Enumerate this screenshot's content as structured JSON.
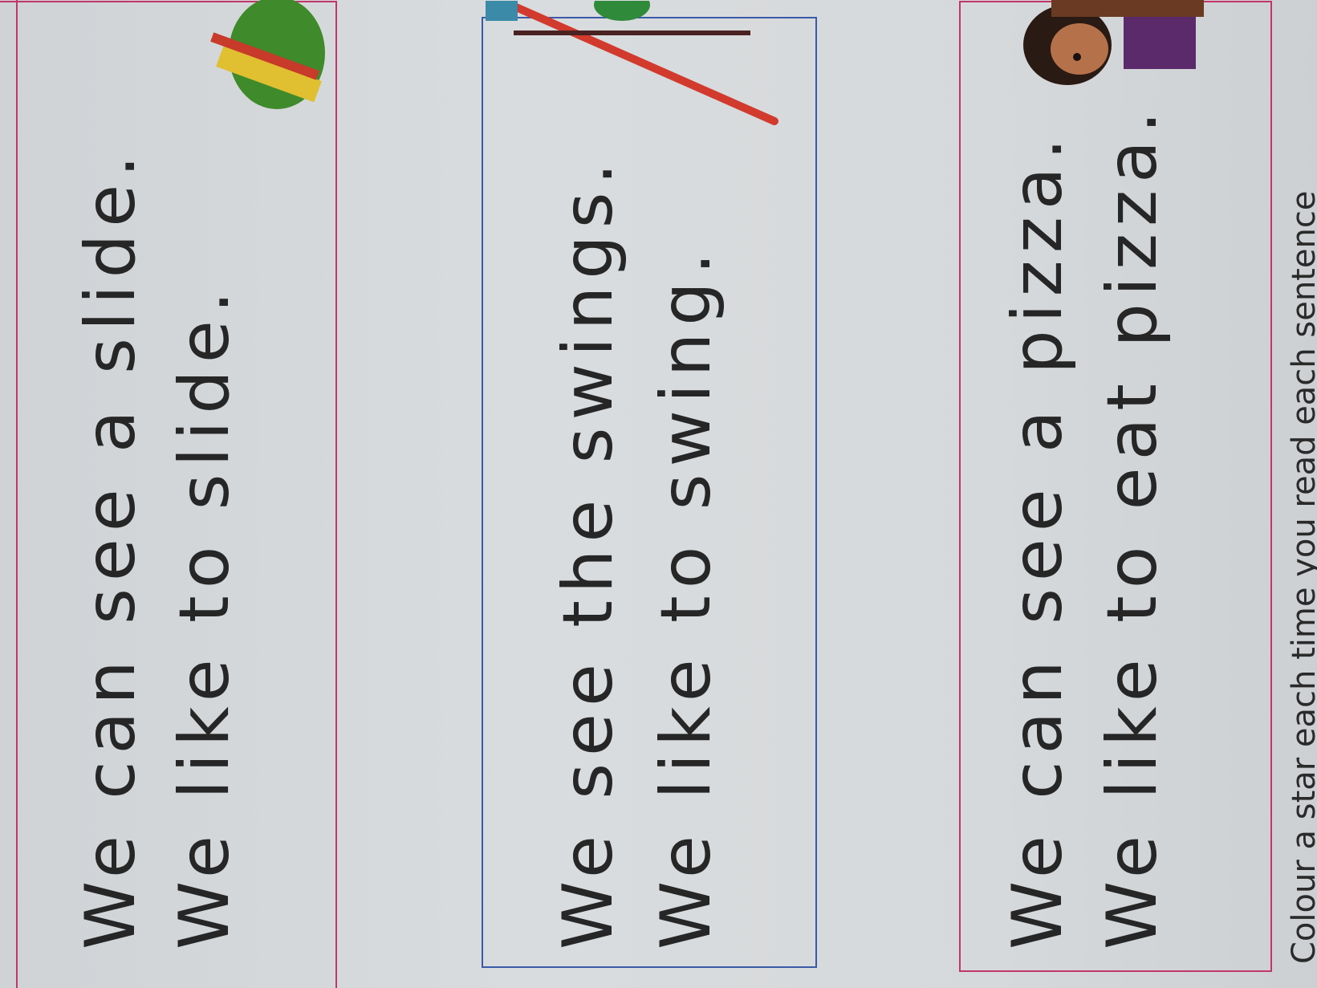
{
  "boxes": [
    {
      "lines": [
        "We can see a slide.",
        "We like to slide."
      ]
    },
    {
      "lines": [
        "We see the swings.",
        "We like to swing."
      ]
    },
    {
      "lines": [
        "We can see a pizza.",
        "We like to eat pizza."
      ]
    }
  ],
  "instruction": "Colour a star each time you read each sentence",
  "colors": {
    "box_border": "#c2366a",
    "box_border_blue": "#3a5aa8",
    "text": "#262626"
  }
}
